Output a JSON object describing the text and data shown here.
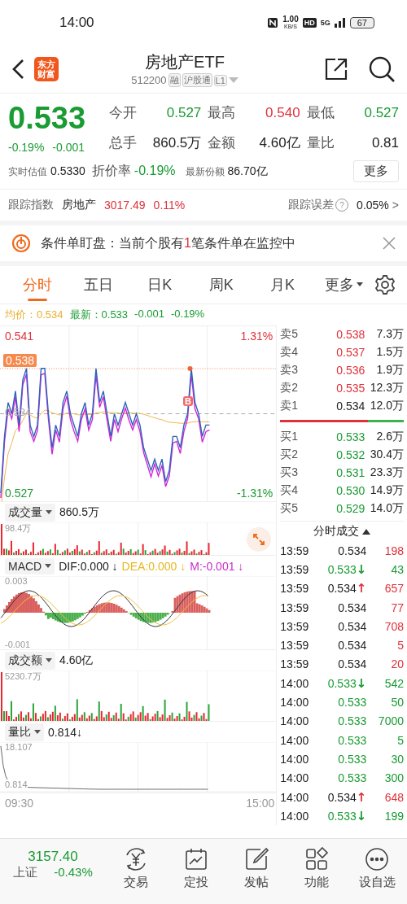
{
  "status_bar": {
    "time": "14:00",
    "net_speed": "1.00",
    "net_unit": "KB/S",
    "hd": "HD",
    "network": "5G",
    "battery": "67"
  },
  "header": {
    "logo": [
      "东方",
      "财富"
    ],
    "title": "房地产ETF",
    "code": "512200",
    "tags": [
      "融",
      "沪股通",
      "L1"
    ]
  },
  "quote": {
    "price": "0.533",
    "change_pct": "-0.19%",
    "change": "-0.001",
    "color": "#1a9b33",
    "stats": [
      {
        "label": "今开",
        "value": "0.527",
        "color": "#1a9b33"
      },
      {
        "label": "最高",
        "value": "0.540",
        "color": "#e0313a"
      },
      {
        "label": "最低",
        "value": "0.527",
        "color": "#1a9b33"
      },
      {
        "label": "总手",
        "value": "860.5万",
        "color": "#222222"
      },
      {
        "label": "金额",
        "value": "4.60亿",
        "color": "#222222"
      },
      {
        "label": "量比",
        "value": "0.81",
        "color": "#222222"
      }
    ],
    "extra": [
      {
        "label": "实时估值",
        "value": "0.5330",
        "color": "#222222",
        "kind": "small"
      },
      {
        "label": "折价率",
        "value": "-0.19%",
        "color": "#1a9b33",
        "kind": "large"
      },
      {
        "label": "最新份额",
        "value": "86.70亿",
        "color": "#222222",
        "kind": "small"
      }
    ],
    "more_button": "更多"
  },
  "tracking": {
    "label": "跟踪指数",
    "index": "房地产",
    "value": "3017.49",
    "change": "0.11%",
    "color": "#e0313a",
    "error_label": "跟踪误差",
    "help": "?",
    "error_value": "0.05%",
    "chevron": ">"
  },
  "alert": {
    "before": "条件单盯盘：当前个股有",
    "count": "1",
    "after": "笔条件单在监控中"
  },
  "tabs": [
    {
      "label": "分时",
      "selected": true
    },
    {
      "label": "五日",
      "selected": false
    },
    {
      "label": "日K",
      "selected": false
    },
    {
      "label": "周K",
      "selected": false
    },
    {
      "label": "月K",
      "selected": false
    },
    {
      "label": "更多",
      "selected": false,
      "kind": "menu"
    }
  ],
  "legend": {
    "avg_label": "均价：",
    "avg": "0.534",
    "last_label": "最新：",
    "last": "0.533",
    "change": "-0.001",
    "change_pct": "-0.19%"
  },
  "price_chart": {
    "high": "0.541",
    "high_pct": "1.31%",
    "low": "0.527",
    "low_pct": "-1.31%",
    "mid": "0.534",
    "peak_tag": "0.538",
    "marker": "B"
  },
  "volume": {
    "label": "成交量",
    "value": "860.5万",
    "max": "98.4万"
  },
  "macd": {
    "label": "MACD",
    "dif": "DIF:0.000 ↓",
    "dea": "DEA:0.000 ↓",
    "m": "M:-0.001 ↓",
    "max": "0.003",
    "min": "-0.001"
  },
  "turnover": {
    "label": "成交额",
    "value": "4.60亿",
    "max": "5230.7万"
  },
  "volume_ratio": {
    "label": "量比",
    "value": "0.814↓",
    "max": "18.107",
    "min": "0.814"
  },
  "time_axis": [
    "09:30",
    "15:00"
  ],
  "order_book": {
    "level": 0.71,
    "asks": [
      {
        "label": "卖5",
        "price": "0.538",
        "volume": "7.3万",
        "color": "#e0313a"
      },
      {
        "label": "卖4",
        "price": "0.537",
        "volume": "1.5万",
        "color": "#e0313a"
      },
      {
        "label": "卖3",
        "price": "0.536",
        "volume": "1.9万",
        "color": "#e0313a"
      },
      {
        "label": "卖2",
        "price": "0.535",
        "volume": "12.3万",
        "color": "#e0313a"
      },
      {
        "label": "卖1",
        "price": "0.534",
        "volume": "12.0万",
        "color": "#222222"
      }
    ],
    "bids": [
      {
        "label": "买1",
        "price": "0.533",
        "volume": "2.6万",
        "color": "#1a9b33"
      },
      {
        "label": "买2",
        "price": "0.532",
        "volume": "30.4万",
        "color": "#1a9b33"
      },
      {
        "label": "买3",
        "price": "0.531",
        "volume": "23.3万",
        "color": "#1a9b33"
      },
      {
        "label": "买4",
        "price": "0.530",
        "volume": "14.9万",
        "color": "#1a9b33"
      },
      {
        "label": "买5",
        "price": "0.529",
        "volume": "14.0万",
        "color": "#1a9b33"
      }
    ]
  },
  "trades": {
    "title": "分时成交",
    "rows": [
      {
        "time": "13:59",
        "price": {
          "text": "0.534",
          "color": "#222222"
        },
        "volume": {
          "text": "198",
          "color": "#e0313a"
        }
      },
      {
        "time": "13:59",
        "price": {
          "text": "0.533",
          "color": "#1a9b33"
        },
        "arrow": {
          "text": "↓",
          "color": "#1a9b33"
        },
        "volume": {
          "text": "43",
          "color": "#1a9b33"
        }
      },
      {
        "time": "13:59",
        "price": {
          "text": "0.534",
          "color": "#222222"
        },
        "arrow": {
          "text": "↑",
          "color": "#e0313a"
        },
        "volume": {
          "text": "657",
          "color": "#e0313a"
        }
      },
      {
        "time": "13:59",
        "price": {
          "text": "0.534",
          "color": "#222222"
        },
        "volume": {
          "text": "77",
          "color": "#e0313a"
        }
      },
      {
        "time": "13:59",
        "price": {
          "text": "0.534",
          "color": "#222222"
        },
        "volume": {
          "text": "708",
          "color": "#e0313a"
        }
      },
      {
        "time": "13:59",
        "price": {
          "text": "0.534",
          "color": "#222222"
        },
        "volume": {
          "text": "5",
          "color": "#e0313a"
        }
      },
      {
        "time": "13:59",
        "price": {
          "text": "0.534",
          "color": "#222222"
        },
        "volume": {
          "text": "20",
          "color": "#e0313a"
        }
      },
      {
        "time": "14:00",
        "price": {
          "text": "0.533",
          "color": "#1a9b33"
        },
        "arrow": {
          "text": "↓",
          "color": "#1a9b33"
        },
        "volume": {
          "text": "542",
          "color": "#1a9b33"
        }
      },
      {
        "time": "14:00",
        "price": {
          "text": "0.533",
          "color": "#1a9b33"
        },
        "volume": {
          "text": "50",
          "color": "#1a9b33"
        }
      },
      {
        "time": "14:00",
        "price": {
          "text": "0.533",
          "color": "#1a9b33"
        },
        "volume": {
          "text": "7000",
          "color": "#1a9b33"
        }
      },
      {
        "time": "14:00",
        "price": {
          "text": "0.533",
          "color": "#1a9b33"
        },
        "volume": {
          "text": "5",
          "color": "#1a9b33"
        }
      },
      {
        "time": "14:00",
        "price": {
          "text": "0.533",
          "color": "#1a9b33"
        },
        "volume": {
          "text": "30",
          "color": "#1a9b33"
        }
      },
      {
        "time": "14:00",
        "price": {
          "text": "0.533",
          "color": "#1a9b33"
        },
        "volume": {
          "text": "300",
          "color": "#1a9b33"
        }
      },
      {
        "time": "14:00",
        "price": {
          "text": "0.534",
          "color": "#222222"
        },
        "arrow": {
          "text": "↑",
          "color": "#e0313a"
        },
        "volume": {
          "text": "648",
          "color": "#e0313a"
        }
      },
      {
        "time": "14:00",
        "price": {
          "text": "0.533",
          "color": "#1a9b33"
        },
        "arrow": {
          "text": "↓",
          "color": "#1a9b33"
        },
        "volume": {
          "text": "199",
          "color": "#1a9b33"
        }
      }
    ]
  },
  "bottom": {
    "index": {
      "value": "3157.40",
      "name": "上证",
      "change": "-0.43%",
      "color": "#1a9b33"
    },
    "actions": [
      {
        "label": "交易",
        "kind": "trade"
      },
      {
        "label": "定投",
        "kind": "invest"
      },
      {
        "label": "发帖",
        "kind": "post"
      },
      {
        "label": "功能",
        "kind": "grid"
      },
      {
        "label": "设自选",
        "kind": "more"
      }
    ]
  }
}
